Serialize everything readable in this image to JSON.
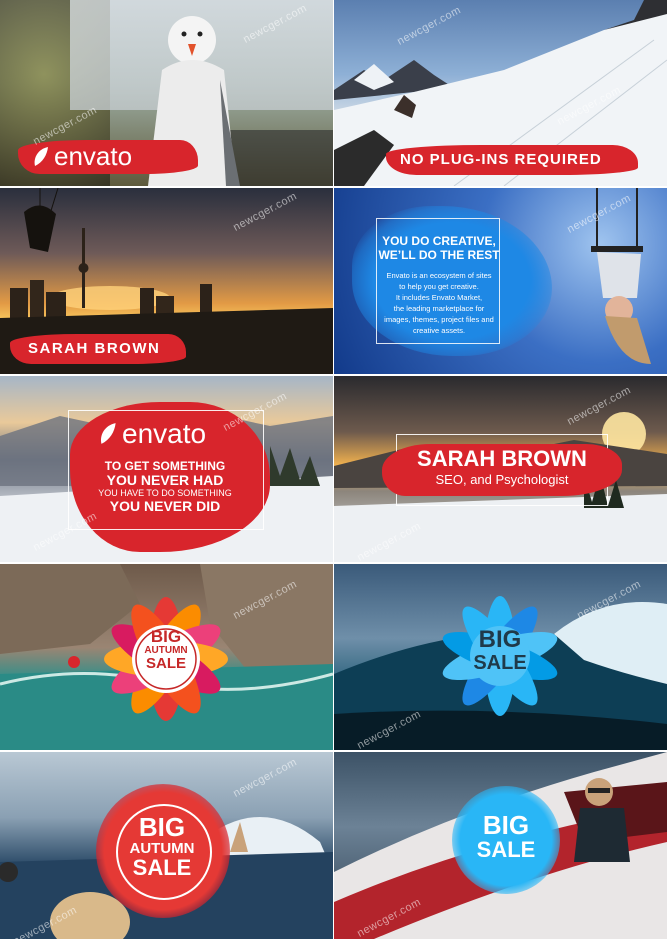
{
  "watermark": "newcger.com",
  "tiles": {
    "t1": {
      "brand": "envato"
    },
    "t2": {
      "caption": "NO PLUG-INS REQUIRED"
    },
    "t3": {
      "caption": "SARAH BROWN"
    },
    "t4": {
      "title_line1": "YOU DO CREATIVE,",
      "title_line2": "WE’LL DO THE REST",
      "body_lines": [
        "Envato is an ecosystem of sites",
        "to help you get creative.",
        "It includes Envato Market,",
        "the leading marketplace for",
        "images, themes, project files and",
        "creative assets."
      ]
    },
    "t5": {
      "brand": "envato",
      "line1": "TO GET SOMETHING",
      "line2": "YOU NEVER HAD",
      "line3": "YOU HAVE TO DO SOMETHING",
      "line4": "YOU NEVER DID"
    },
    "t6": {
      "name": "SARAH BROWN",
      "subtitle": "SEO, and Psychologist"
    },
    "t7": {
      "line1": "BIG",
      "line2": "AUTUMN",
      "line3": "SALE"
    },
    "t8": {
      "line1": "BIG",
      "line2": "SALE"
    },
    "t9": {
      "line1": "BIG",
      "line2": "AUTUMN",
      "line3": "SALE"
    },
    "t10": {
      "line1": "BIG",
      "line2": "SALE"
    }
  },
  "colors": {
    "brand_red": "#d8252c",
    "blue_accent": "#1e88e5",
    "light_blue": "#29b6f6",
    "orange": "#f57c00"
  }
}
